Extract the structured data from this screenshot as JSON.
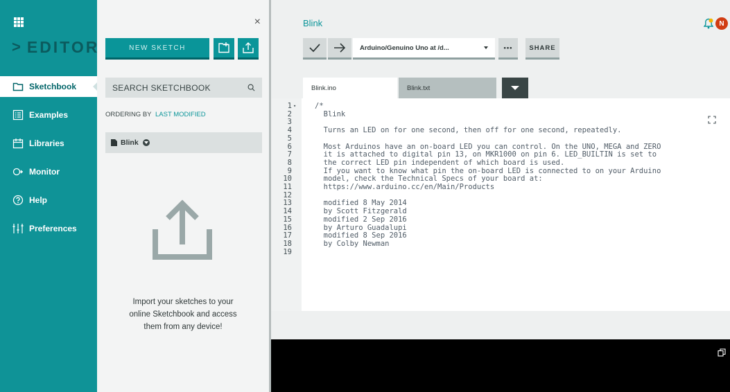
{
  "nav": {
    "brand": "EDITOR",
    "items": [
      {
        "label": "Sketchbook",
        "icon": "folder-icon"
      },
      {
        "label": "Examples",
        "icon": "list-icon"
      },
      {
        "label": "Libraries",
        "icon": "library-icon"
      },
      {
        "label": "Monitor",
        "icon": "monitor-icon"
      },
      {
        "label": "Help",
        "icon": "help-icon"
      },
      {
        "label": "Preferences",
        "icon": "sliders-icon"
      }
    ]
  },
  "panel": {
    "new_sketch": "NEW SKETCH",
    "search_placeholder": "SEARCH SKETCHBOOK",
    "ordering_label": "ORDERING BY",
    "ordering_value": "LAST MODIFIED",
    "sketch_name": "Blink",
    "import_line1": "Import your sketches to your",
    "import_line2": "online Sketchbook and access",
    "import_line3": "them from any device!"
  },
  "editor": {
    "title": "Blink",
    "avatar": "N",
    "board": "Arduino/Genuino Uno at /d...",
    "more": "•••",
    "share": "SHARE",
    "tabs": [
      {
        "label": "Blink.ino"
      },
      {
        "label": "Blink.txt"
      }
    ],
    "lines": [
      {
        "n": "1",
        "t": "/*"
      },
      {
        "n": "2",
        "t": "  Blink"
      },
      {
        "n": "3",
        "t": ""
      },
      {
        "n": "4",
        "t": "  Turns an LED on for one second, then off for one second, repeatedly."
      },
      {
        "n": "5",
        "t": ""
      },
      {
        "n": "6",
        "t": "  Most Arduinos have an on-board LED you can control. On the UNO, MEGA and ZERO"
      },
      {
        "n": "7",
        "t": "  it is attached to digital pin 13, on MKR1000 on pin 6. LED_BUILTIN is set to"
      },
      {
        "n": "8",
        "t": "  the correct LED pin independent of which board is used."
      },
      {
        "n": "9",
        "t": "  If you want to know what pin the on-board LED is connected to on your Arduino"
      },
      {
        "n": "10",
        "t": "  model, check the Technical Specs of your board at:"
      },
      {
        "n": "11",
        "t": "  https://www.arduino.cc/en/Main/Products"
      },
      {
        "n": "12",
        "t": ""
      },
      {
        "n": "13",
        "t": "  modified 8 May 2014"
      },
      {
        "n": "14",
        "t": "  by Scott Fitzgerald"
      },
      {
        "n": "15",
        "t": "  modified 2 Sep 2016"
      },
      {
        "n": "16",
        "t": "  by Arturo Guadalupi"
      },
      {
        "n": "17",
        "t": "  modified 8 Sep 2016"
      },
      {
        "n": "18",
        "t": "  by Colby Newman"
      },
      {
        "n": "19",
        "t": ""
      }
    ]
  },
  "colors": {
    "teal": "#0f9397",
    "teal_dark": "#006468",
    "avatar": "#d13c12",
    "bell": "#f2b705"
  }
}
